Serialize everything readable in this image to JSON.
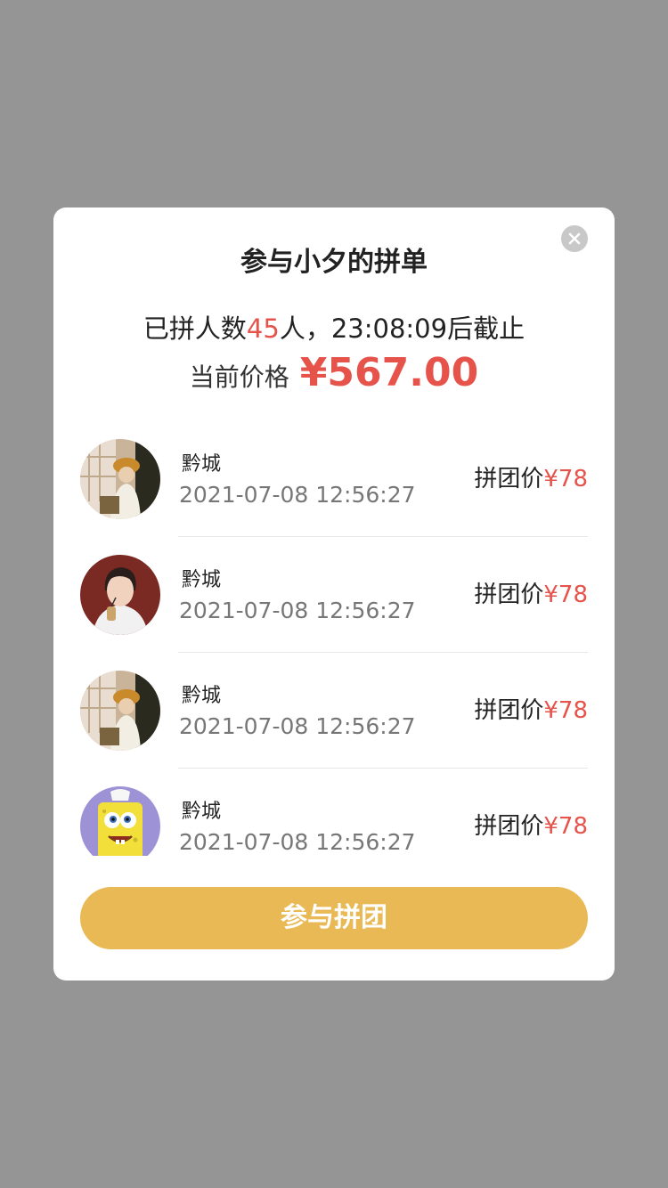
{
  "modal": {
    "title": "参与小夕的拼单",
    "info": {
      "prefix": "已拼人数",
      "count": "45",
      "suffix": "人，23:08:09后截止"
    },
    "price": {
      "label": "当前价格",
      "value": "¥567.00"
    },
    "members": [
      {
        "name": "黔城",
        "time": "2021-07-08 12:56:27",
        "price_label": "拼团价",
        "price": "¥78",
        "avatar": "woman-by-window-photo"
      },
      {
        "name": "黔城",
        "time": "2021-07-08 12:56:27",
        "price_label": "拼团价",
        "price": "¥78",
        "avatar": "cartoon-man-avatar"
      },
      {
        "name": "黔城",
        "time": "2021-07-08 12:56:27",
        "price_label": "拼团价",
        "price": "¥78",
        "avatar": "woman-by-window-photo"
      },
      {
        "name": "黔城",
        "time": "2021-07-08 12:56:27",
        "price_label": "拼团价",
        "price": "¥78",
        "avatar": "spongebob-avatar"
      }
    ],
    "join_button": "参与拼团",
    "close_icon": "close-icon"
  },
  "colors": {
    "overlay": "#959595",
    "accent_red": "#e5534b",
    "button_gold": "#e9b955"
  }
}
